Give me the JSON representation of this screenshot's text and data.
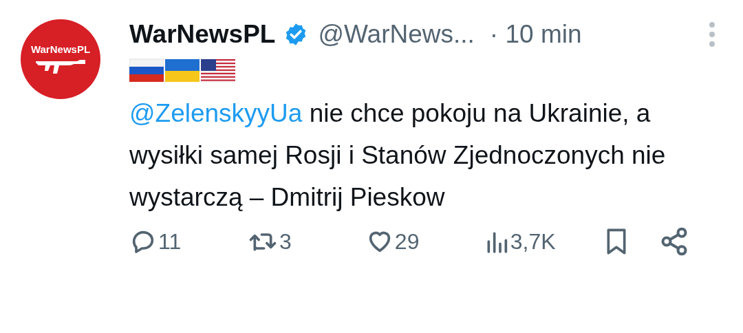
{
  "tweet": {
    "avatar": {
      "logo_text": "WarNewsPL"
    },
    "author": {
      "name": "WarNewsPL",
      "verified": true,
      "handle": "@WarNews...",
      "time": "· 10 min"
    },
    "mention": "@ZelenskyyUa",
    "text": " nie chce pokoju na Ukrainie, a wysiłki samej Rosji i Stanów Zjednoczonych nie wystarczą – Dmitrij Pieskow",
    "actions": [
      {
        "kind": "reply",
        "count": "11"
      },
      {
        "kind": "retweet",
        "count": "3"
      },
      {
        "kind": "like",
        "count": "29"
      },
      {
        "kind": "views",
        "count": "3,7K"
      },
      {
        "kind": "bookmark"
      },
      {
        "kind": "share"
      }
    ]
  }
}
